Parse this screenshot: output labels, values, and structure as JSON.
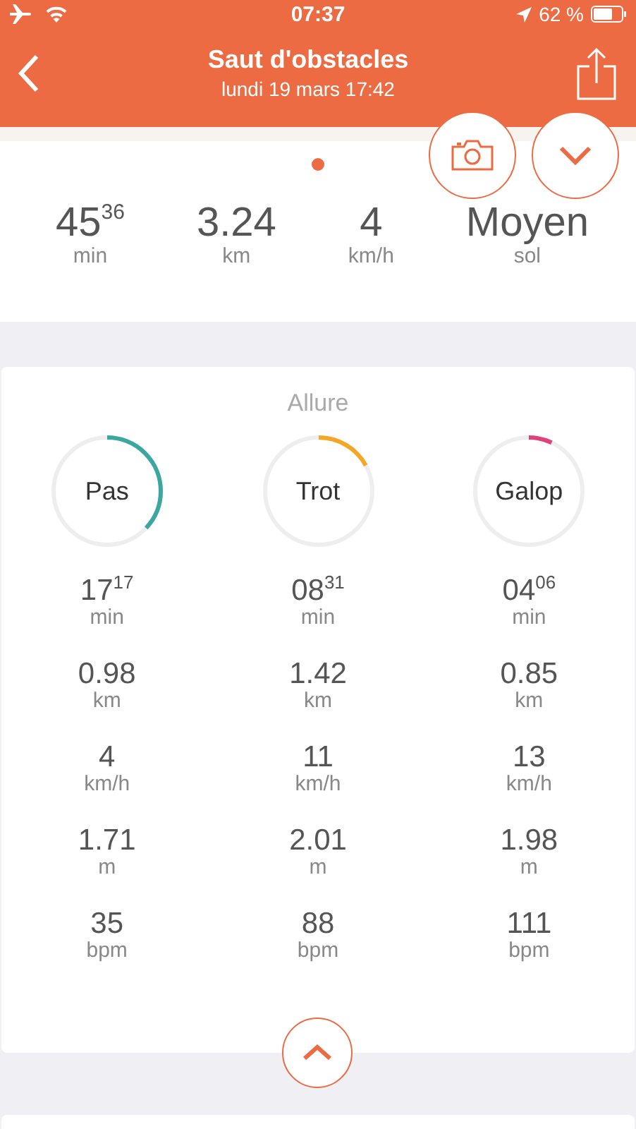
{
  "status_bar": {
    "time": "07:37",
    "battery": "62 %"
  },
  "nav": {
    "title": "Saut d'obstacles",
    "subtitle": "lundi 19 mars 17:42"
  },
  "pager": [
    {
      "selected": true
    }
  ],
  "summary": [
    {
      "value": "45$^{36}$",
      "unit": "min"
    },
    {
      "value": "3.24",
      "unit": "km"
    },
    {
      "value": "4",
      "unit": "km/h"
    },
    {
      "value": "Moyen",
      "unit": "sol"
    }
  ],
  "gait_card": {
    "title": "Allure",
    "gaits": [
      {
        "name": "Pas",
        "level": 0.37,
        "color": "#3aa8a0",
        "stats": [
          {
            "value": "17$^{17}$",
            "unit": "min"
          },
          {
            "value": "0.98",
            "unit": "km"
          },
          {
            "value": "4",
            "unit": "km/h"
          },
          {
            "value": "1.71",
            "unit": "m"
          },
          {
            "value": "35",
            "unit": "bpm"
          }
        ]
      },
      {
        "name": "Trot",
        "level": 0.17,
        "color": "#f5a623",
        "stats": [
          {
            "value": "08$^{31}$",
            "unit": "min"
          },
          {
            "value": "1.42",
            "unit": "km"
          },
          {
            "value": "11",
            "unit": "km/h"
          },
          {
            "value": "2.01",
            "unit": "m"
          },
          {
            "value": "88",
            "unit": "bpm"
          }
        ]
      },
      {
        "name": "Galop",
        "level": 0.07,
        "color": "#e0417a",
        "stats": [
          {
            "value": "04$^{06}$",
            "unit": "min"
          },
          {
            "value": "0.85",
            "unit": "km"
          },
          {
            "value": "13",
            "unit": "km/h"
          },
          {
            "value": "1.98",
            "unit": "m"
          },
          {
            "value": "111",
            "unit": "bpm"
          }
        ]
      }
    ]
  }
}
